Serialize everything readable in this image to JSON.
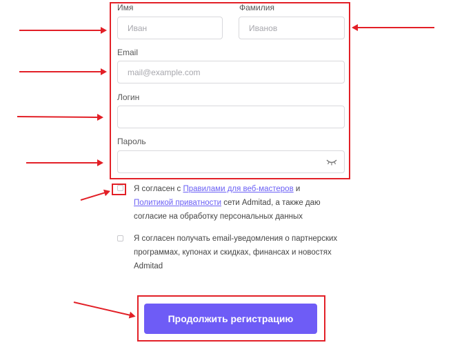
{
  "form": {
    "first_name": {
      "label": "Имя",
      "placeholder": "Иван"
    },
    "last_name": {
      "label": "Фамилия",
      "placeholder": "Иванов"
    },
    "email": {
      "label": "Email",
      "placeholder": "mail@example.com"
    },
    "login": {
      "label": "Логин",
      "placeholder": ""
    },
    "password": {
      "label": "Пароль",
      "placeholder": "",
      "toggle_icon": "eye-closed-icon"
    }
  },
  "consents": {
    "terms": {
      "prefix": "Я согласен с ",
      "link1": "Правилами для веб-мастеров",
      "mid": " и",
      "link2": "Политикой приватности",
      "suffix": " сети Admitad, а также даю",
      "line3": "согласие на обработку персональных данных"
    },
    "newsletter": {
      "line1": "Я согласен получать email-уведомления о партнерских",
      "line2": "программах, купонах и скидках, финансах и новостях",
      "line3": "Admitad"
    }
  },
  "submit": {
    "label": "Продолжить регистрацию"
  },
  "colors": {
    "accent": "#6e5cf6",
    "annotation": "#e21f26",
    "link": "#6a5ff5"
  }
}
